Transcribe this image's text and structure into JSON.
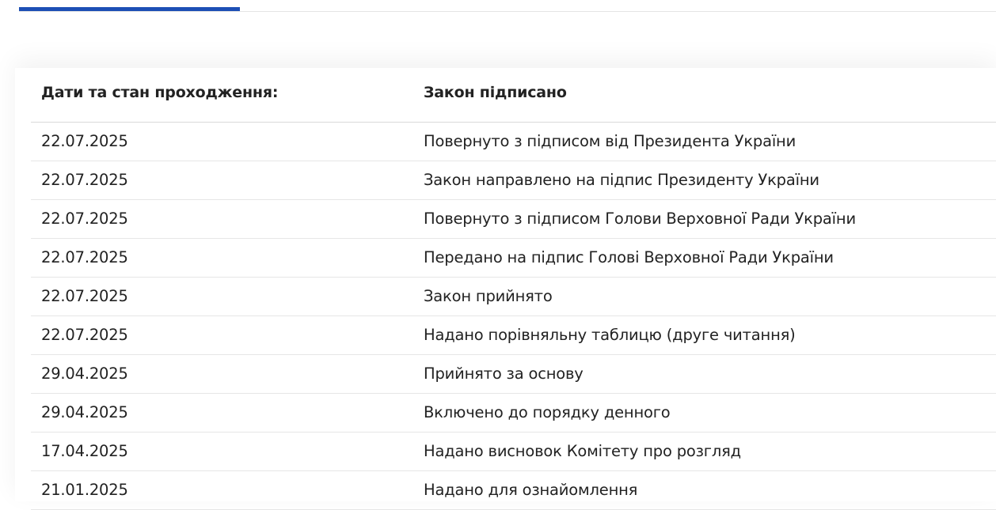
{
  "header": {
    "date_label": "Дати та стан проходження:",
    "status_value": "Закон підписано"
  },
  "rows": [
    {
      "date": "22.07.2025",
      "event": "Повернуто з підписом від Президента України"
    },
    {
      "date": "22.07.2025",
      "event": "Закон направлено на підпис Президенту України"
    },
    {
      "date": "22.07.2025",
      "event": "Повернуто з підписом Голови Верховної Ради України"
    },
    {
      "date": "22.07.2025",
      "event": "Передано на підпис Голові Верховної Ради України"
    },
    {
      "date": "22.07.2025",
      "event": "Закон прийнято"
    },
    {
      "date": "22.07.2025",
      "event": "Надано порівняльну таблицю (друге читання)"
    },
    {
      "date": "29.04.2025",
      "event": "Прийнято за основу"
    },
    {
      "date": "29.04.2025",
      "event": "Включено до порядку денного"
    },
    {
      "date": "17.04.2025",
      "event": "Надано висновок Комітету про розгляд"
    },
    {
      "date": "21.01.2025",
      "event": "Надано для ознайомлення"
    }
  ],
  "colors": {
    "accent": "#1d4fb5",
    "divider": "#e6e6e6",
    "text": "#222222"
  }
}
